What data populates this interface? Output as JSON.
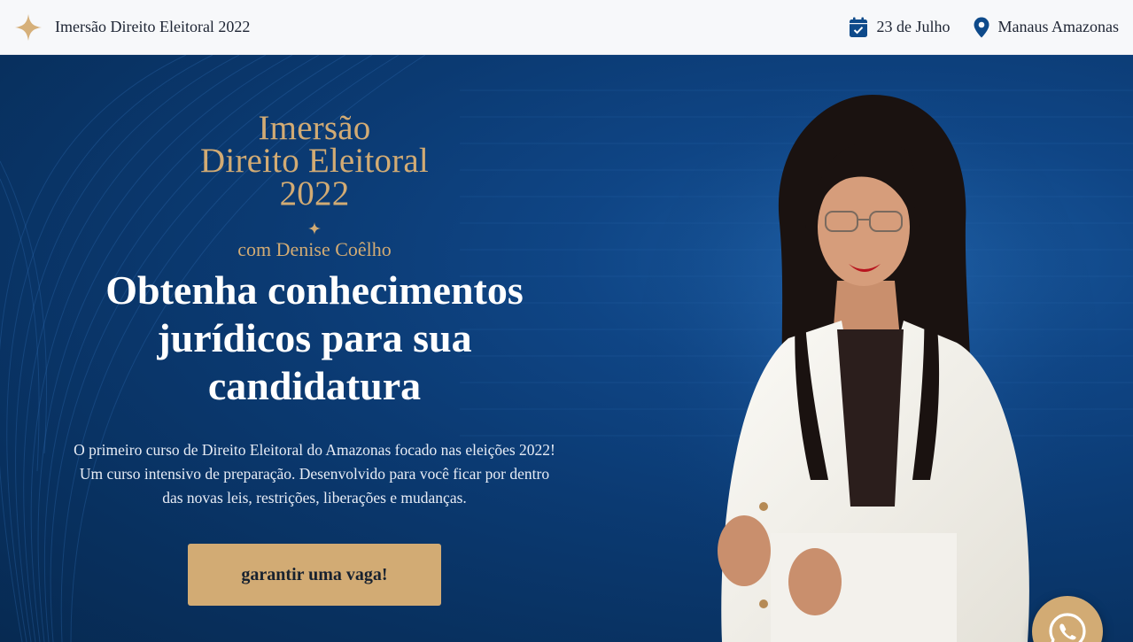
{
  "header": {
    "brand_icon": "four-point-star-icon",
    "title": "Imersão Direito Eleitoral 2022",
    "date_icon": "calendar-icon",
    "date": "23 de Julho",
    "location_icon": "map-pin-icon",
    "location": "Manaus Amazonas"
  },
  "hero": {
    "event_title_line1": "Imersão",
    "event_title_line2": "Direito Eleitoral",
    "event_title_line3": "2022",
    "subtitle": "com Denise Coêlho",
    "headline_line1": "Obtenha conhecimentos",
    "headline_line2": "jurídicos para sua",
    "headline_line3": "candidatura",
    "lead_line1": "O primeiro curso de Direito Eleitoral do Amazonas focado nas eleições 2022!",
    "lead_line2": "Um curso intensivo de preparação. Desenvolvido para você ficar por dentro",
    "lead_line3": "das novas leis, restrições, liberações e mudanças.",
    "cta_label": "garantir uma vaga!"
  },
  "floating": {
    "icon": "whatsapp-icon"
  },
  "colors": {
    "accent": "#d2ab74",
    "hero_bg": "#0b3a72",
    "header_bg": "#f7f8fa",
    "icon_blue": "#0e4a8a"
  }
}
